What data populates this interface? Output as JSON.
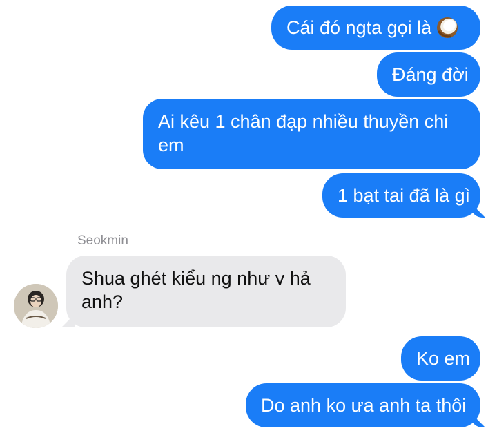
{
  "messages": [
    {
      "text": "Cái đó ngta gọi là",
      "emoji": "coconut-emoji",
      "direction": "outgoing"
    },
    {
      "text": "Đáng đời",
      "direction": "outgoing"
    },
    {
      "text": "Ai kêu 1 chân đạp nhiều thuyền chi em",
      "direction": "outgoing"
    },
    {
      "text": "1 bạt tai đã là gì",
      "direction": "outgoing"
    },
    {
      "sender": "Seokmin",
      "text": "Shua ghét kiểu ng như v hả anh?",
      "direction": "incoming"
    },
    {
      "text": "Ko em",
      "direction": "outgoing"
    },
    {
      "text": "Do anh ko ưa anh ta thôi",
      "direction": "outgoing"
    }
  ],
  "colors": {
    "outgoing_bubble": "#1a7df7",
    "incoming_bubble": "#e9e9eb",
    "sender_name": "#8e8e93"
  }
}
